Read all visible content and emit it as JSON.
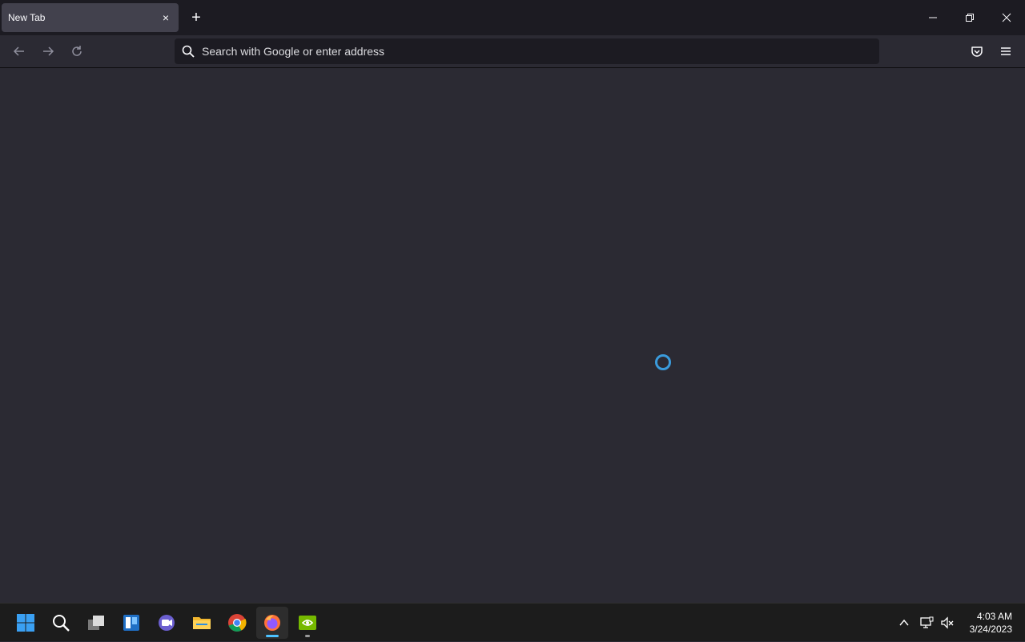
{
  "browser": {
    "tab": {
      "title": "New Tab",
      "close_label": "×"
    },
    "new_tab_label": "+",
    "urlbar": {
      "placeholder": "Search with Google or enter address",
      "value": ""
    },
    "window_controls": [
      "minimize",
      "restore",
      "close"
    ]
  },
  "content": {
    "loading": true,
    "spinner_color": "#3a9bdc"
  },
  "taskbar": {
    "apps": [
      {
        "name": "start",
        "icon": "windows-logo-icon"
      },
      {
        "name": "search",
        "icon": "search-icon"
      },
      {
        "name": "task-view",
        "icon": "task-view-icon"
      },
      {
        "name": "widgets",
        "icon": "widgets-icon"
      },
      {
        "name": "teams-chat",
        "icon": "chat-icon"
      },
      {
        "name": "file-explorer",
        "icon": "folder-icon"
      },
      {
        "name": "chrome",
        "icon": "chrome-icon"
      },
      {
        "name": "firefox",
        "icon": "firefox-icon",
        "active": true
      },
      {
        "name": "nvidia",
        "icon": "nvidia-icon",
        "running": true
      }
    ],
    "clock": {
      "time": "4:03 AM",
      "date": "3/24/2023"
    }
  },
  "colors": {
    "accent": "#0a84ff",
    "tab_bg": "#42414d",
    "chrome_bg": "#1c1b22",
    "content_bg": "#2b2a33"
  }
}
